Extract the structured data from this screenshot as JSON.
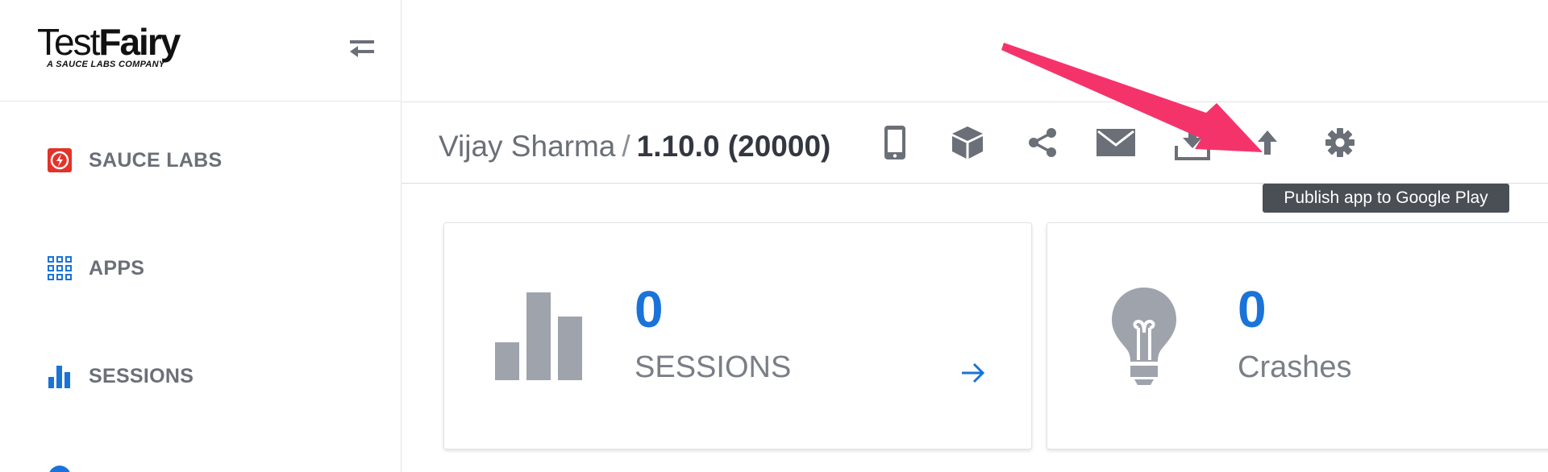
{
  "app": {
    "logo": {
      "brand_part1": "Test",
      "brand_part2": "Fairy",
      "subtitle": "A SAUCE LABS COMPANY"
    }
  },
  "sidebar": {
    "items": [
      {
        "label": "SAUCE LABS",
        "icon": "sauce-labs-icon",
        "icon_color": "#e2332a"
      },
      {
        "label": "APPS",
        "icon": "apps-grid-icon",
        "icon_color": "#1a73d9"
      },
      {
        "label": "SESSIONS",
        "icon": "sessions-chart-icon",
        "icon_color": "#1a73d9"
      }
    ]
  },
  "header": {
    "owner": "Vijay Sharma",
    "separator": "/",
    "version": "1.10.0 (20000)",
    "actions": [
      {
        "name": "devices-icon"
      },
      {
        "name": "build-package-icon"
      },
      {
        "name": "share-icon"
      },
      {
        "name": "email-icon"
      },
      {
        "name": "download-icon"
      },
      {
        "name": "publish-upload-icon"
      },
      {
        "name": "settings-gear-icon"
      }
    ]
  },
  "tooltip": {
    "text": "Publish app to Google Play"
  },
  "cards": [
    {
      "value": "0",
      "label": "SESSIONS",
      "icon": "bar-chart-icon"
    },
    {
      "value": "0",
      "label": "Crashes",
      "icon": "lightbulb-icon"
    }
  ],
  "colors": {
    "accent": "#1a73d9",
    "icon_gray": "#6b6f77",
    "annotation": "#f5336b",
    "sauce_red": "#e2332a"
  }
}
